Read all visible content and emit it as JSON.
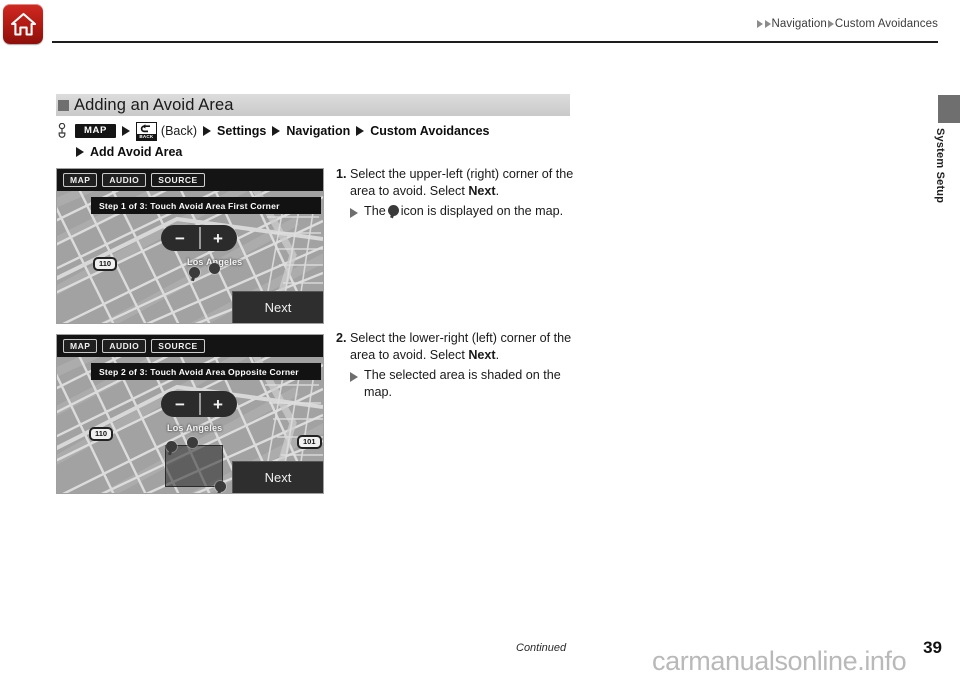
{
  "header": {
    "home_icon": "home-icon",
    "breadcrumb": {
      "arrow1": "▶",
      "arrow2": "▶",
      "item1": "Navigation",
      "arrow3": "▶",
      "item2": "Custom Avoidances"
    }
  },
  "side_tab": {
    "label": "System Setup"
  },
  "section": {
    "bullet": "square-bullet-icon",
    "title": "Adding an Avoid Area"
  },
  "path": {
    "hand_icon": "hand-pointer-icon",
    "map_key": "MAP",
    "back_key_icon": "back-arrow-icon",
    "back_key_label": "BACK",
    "back_text": "(Back)",
    "settings": "Settings",
    "navigation": "Navigation",
    "custom_avoidances": "Custom Avoidances",
    "add_avoid_area": "Add Avoid Area"
  },
  "screenshots": [
    {
      "name": "step-1-screenshot",
      "toolbar": [
        "MAP",
        "AUDIO",
        "SOURCE"
      ],
      "banner": "Step 1 of 3: Touch Avoid Area First Corner",
      "zoom_out": "−",
      "zoom_in": "+",
      "highway_badge": "110",
      "city_label": "Los Angeles",
      "next_label": "Next",
      "second_badge": ""
    },
    {
      "name": "step-2-screenshot",
      "toolbar": [
        "MAP",
        "AUDIO",
        "SOURCE"
      ],
      "banner": "Step 2 of 3: Touch Avoid Area Opposite Corner",
      "zoom_out": "−",
      "zoom_in": "+",
      "highway_badge": "110",
      "city_label": "Los Angeles",
      "next_label": "Next",
      "second_badge": "101"
    }
  ],
  "instructions": [
    {
      "number": "1.",
      "text_before_bold": "Select the upper-left (right) corner of the area to avoid. Select ",
      "bold": "Next",
      "text_after_bold": ".",
      "sub_before_icon": "The",
      "sub_icon": "map-pin-icon",
      "sub_after_icon": "icon is displayed on the map."
    },
    {
      "number": "2.",
      "text_before_bold": "Select the lower-right (left) corner of the area to avoid. Select ",
      "bold": "Next",
      "text_after_bold": ".",
      "sub_before_icon": "The selected area is shaded on the map.",
      "sub_icon": "",
      "sub_after_icon": ""
    }
  ],
  "footer": {
    "continued": "Continued",
    "page_number": "39",
    "watermark": "carmanualsonline.info"
  },
  "colors": {
    "home_red": "#b41b14",
    "section_bar": "#d2d2d2",
    "side_tab": "#6f6f6f",
    "watermark": "#b9b9b9"
  }
}
